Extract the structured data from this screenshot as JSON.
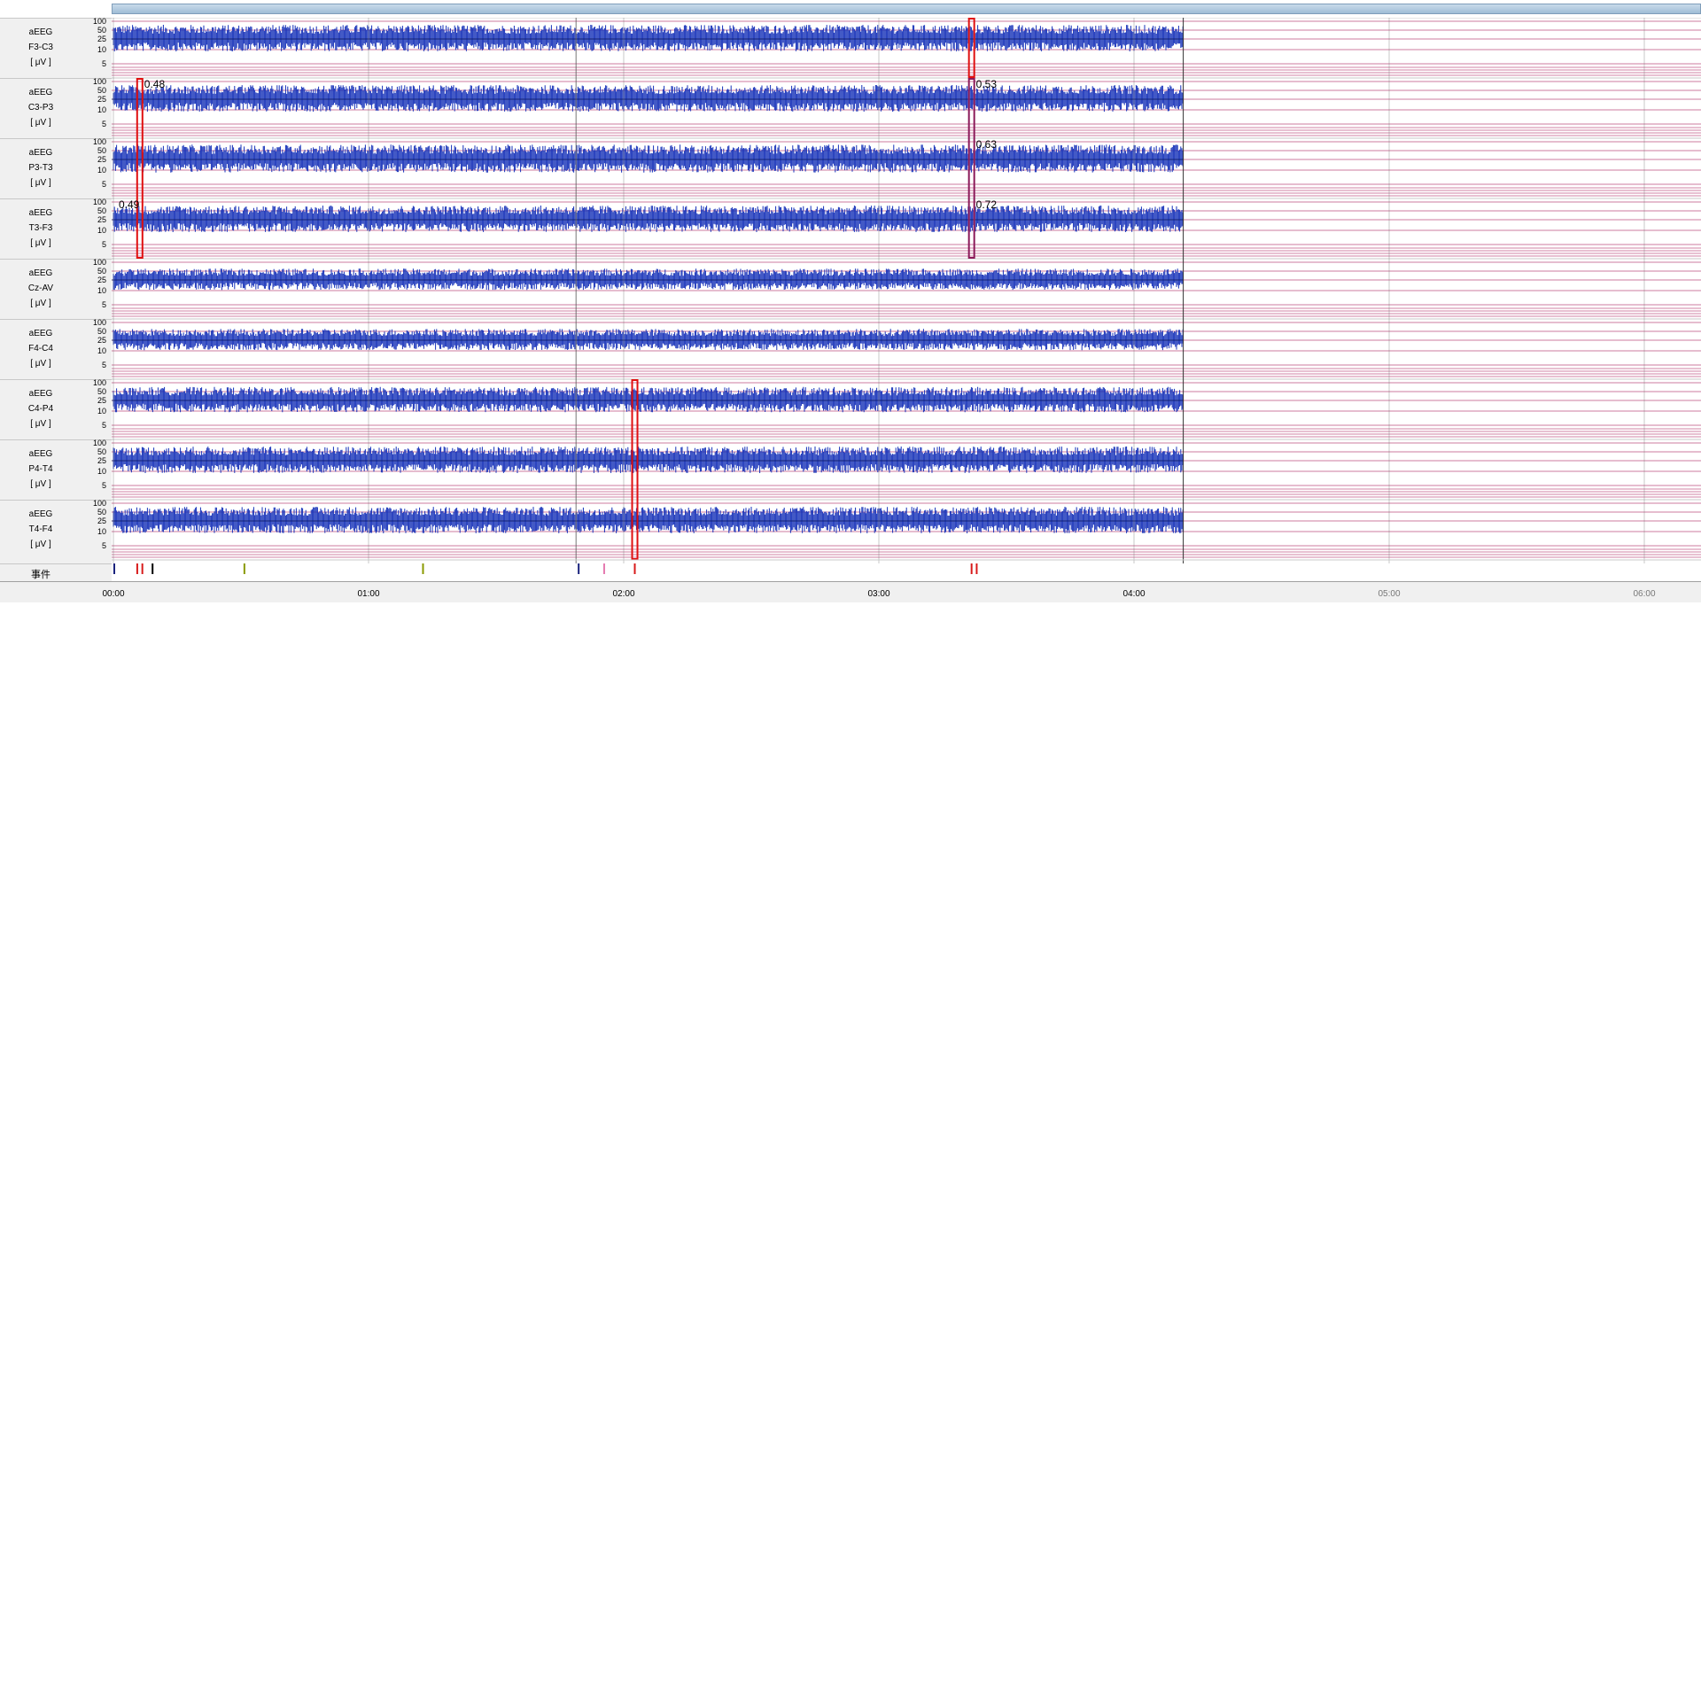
{
  "channels": [
    {
      "type": "aEEG",
      "lead": "F3-C3",
      "unit": "[ μV ]",
      "amp_scale": 1.0
    },
    {
      "type": "aEEG",
      "lead": "C3-P3",
      "unit": "[ μV ]",
      "amp_scale": 1.0
    },
    {
      "type": "aEEG",
      "lead": "P3-T3",
      "unit": "[ μV ]",
      "amp_scale": 1.05
    },
    {
      "type": "aEEG",
      "lead": "T3-F3",
      "unit": "[ μV ]",
      "amp_scale": 1.0
    },
    {
      "type": "aEEG",
      "lead": "Cz-AV",
      "unit": "[ μV ]",
      "amp_scale": 0.8
    },
    {
      "type": "aEEG",
      "lead": "F4-C4",
      "unit": "[ μV ]",
      "amp_scale": 0.8
    },
    {
      "type": "aEEG",
      "lead": "C4-P4",
      "unit": "[ μV ]",
      "amp_scale": 0.95
    },
    {
      "type": "aEEG",
      "lead": "P4-T4",
      "unit": "[ μV ]",
      "amp_scale": 1.0
    },
    {
      "type": "aEEG",
      "lead": "T4-F4",
      "unit": "[ μV ]",
      "amp_scale": 1.0
    }
  ],
  "amplitude_ticks": [
    "100",
    "50",
    "25",
    "10",
    "5"
  ],
  "events_label": "事件",
  "time_axis": {
    "labels": [
      "00:00",
      "01:00",
      "02:00",
      "03:00",
      "04:00",
      "05:00",
      "06:00"
    ],
    "recorded_until_hours": 4.2,
    "total_hours": 6
  },
  "annotations": [
    {
      "text": "0.48",
      "channel": 1,
      "time_h": 0.1
    },
    {
      "text": "0.53",
      "channel": 1,
      "time_h": 3.36
    },
    {
      "text": "0.63",
      "channel": 2,
      "time_h": 3.36
    },
    {
      "text": "0.49",
      "channel": 3,
      "time_h": 0.0
    },
    {
      "text": "0.72",
      "channel": 3,
      "time_h": 3.36
    }
  ],
  "event_markers": [
    {
      "time_h": 0.0,
      "color": "#1a237e"
    },
    {
      "time_h": 0.09,
      "color": "#d81b1b"
    },
    {
      "time_h": 0.11,
      "color": "#d81b1b"
    },
    {
      "time_h": 0.15,
      "color": "#000000"
    },
    {
      "time_h": 0.51,
      "color": "#8a9a00"
    },
    {
      "time_h": 1.21,
      "color": "#8a9a00"
    },
    {
      "time_h": 1.82,
      "color": "#1a237e"
    },
    {
      "time_h": 1.92,
      "color": "#e57ab0"
    },
    {
      "time_h": 2.04,
      "color": "#d81b1b"
    },
    {
      "time_h": 3.36,
      "color": "#d81b1b"
    },
    {
      "time_h": 3.38,
      "color": "#d81b1b"
    }
  ],
  "highlight_boxes": [
    {
      "from_channel": 0,
      "to_channel": 0,
      "time_h": 3.36,
      "color": "#e01010"
    },
    {
      "from_channel": 1,
      "to_channel": 3,
      "time_h": 0.1,
      "color": "#e01010"
    },
    {
      "from_channel": 1,
      "to_channel": 3,
      "time_h": 3.36,
      "color": "#8b1a5a"
    },
    {
      "from_channel": 6,
      "to_channel": 8,
      "time_h": 2.04,
      "color": "#e01010"
    }
  ],
  "colors": {
    "trace": "#1430b8",
    "grid_band": "#b0306a",
    "background": "#ffffff",
    "panel": "#f0f0f0"
  }
}
